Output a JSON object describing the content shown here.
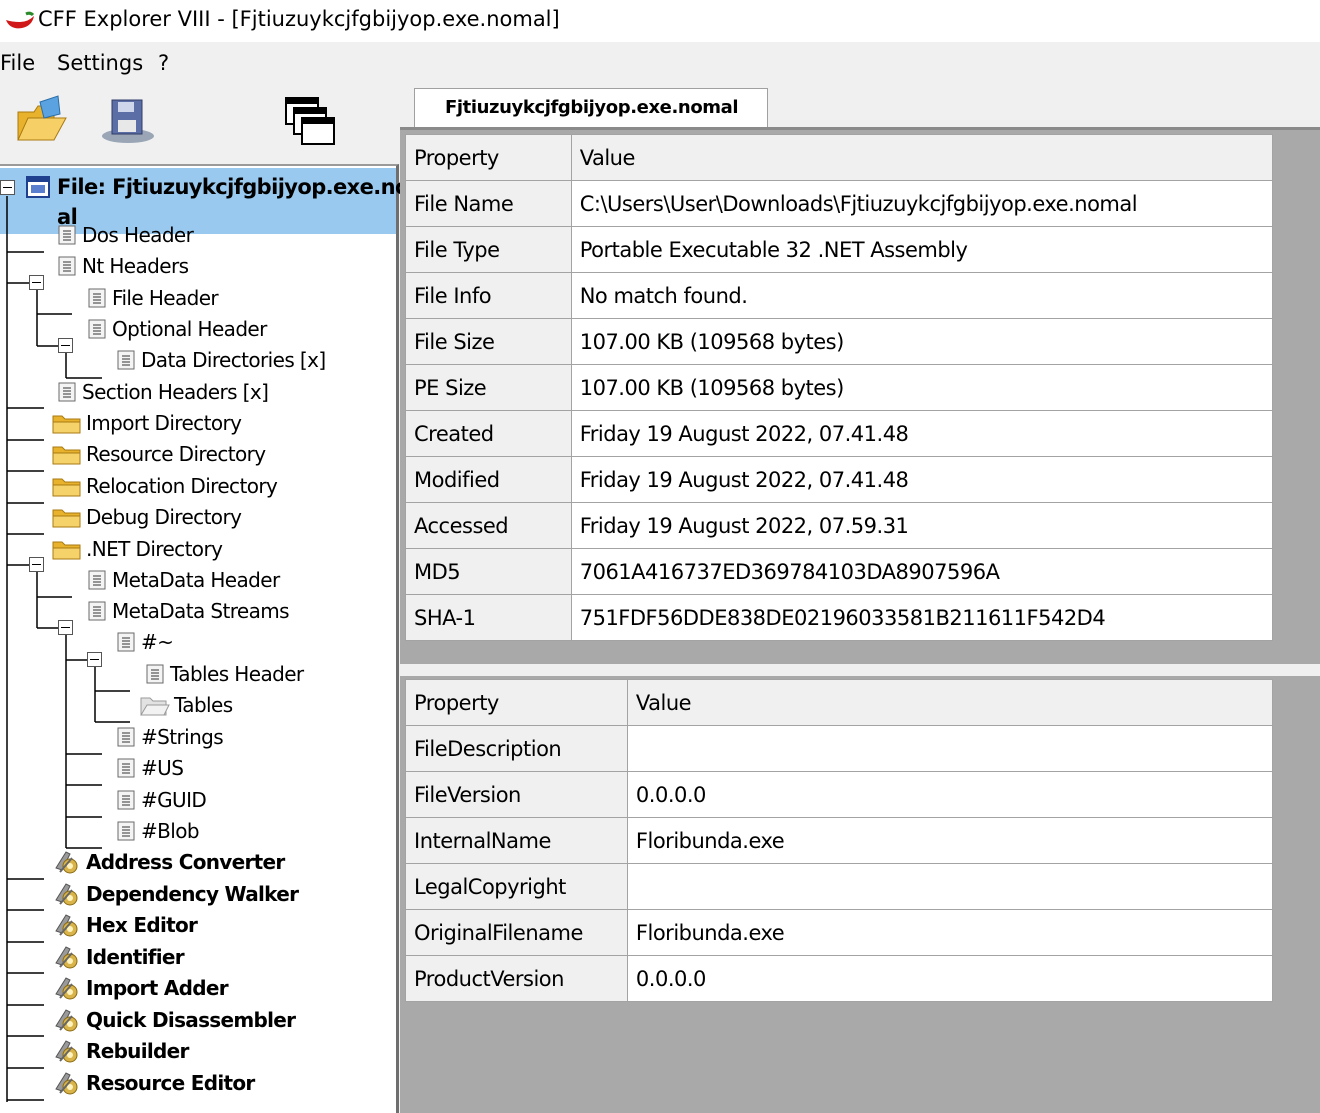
{
  "window": {
    "title": "CFF Explorer VIII - [Fjtiuzuykcjfgbijyop.exe.nomal]"
  },
  "menu": [
    "File",
    "Settings",
    "?"
  ],
  "toolbar": {
    "open_icon": "open-folder-icon",
    "save_icon": "save-disk-icon",
    "windows_icon": "windows-cascade-icon"
  },
  "tree": {
    "root": "File: Fjtiuzuykcjfgbijyop.exe.nom",
    "root_wrap": "al",
    "items": [
      {
        "label": "Dos Header",
        "icon": "doc-icon",
        "bold": false
      },
      {
        "label": "Nt Headers",
        "icon": "doc-icon",
        "bold": false
      },
      {
        "label": "File Header",
        "icon": "doc-icon",
        "bold": false
      },
      {
        "label": "Optional Header",
        "icon": "doc-icon",
        "bold": false
      },
      {
        "label": "Data Directories [x]",
        "icon": "doc-icon",
        "bold": false
      },
      {
        "label": "Section Headers [x]",
        "icon": "doc-icon",
        "bold": false
      },
      {
        "label": "Import Directory",
        "icon": "folder-icon",
        "bold": false
      },
      {
        "label": "Resource Directory",
        "icon": "folder-icon",
        "bold": false
      },
      {
        "label": "Relocation Directory",
        "icon": "folder-icon",
        "bold": false
      },
      {
        "label": "Debug Directory",
        "icon": "folder-icon",
        "bold": false
      },
      {
        "label": ".NET Directory",
        "icon": "folder-icon",
        "bold": false
      },
      {
        "label": "MetaData Header",
        "icon": "doc-icon",
        "bold": false
      },
      {
        "label": "MetaData Streams",
        "icon": "doc-icon",
        "bold": false
      },
      {
        "label": "#~",
        "icon": "doc-icon",
        "bold": false
      },
      {
        "label": "Tables Header",
        "icon": "doc-icon",
        "bold": false
      },
      {
        "label": "Tables",
        "icon": "folder-open-icon",
        "bold": false
      },
      {
        "label": "#Strings",
        "icon": "doc-icon",
        "bold": false
      },
      {
        "label": "#US",
        "icon": "doc-icon",
        "bold": false
      },
      {
        "label": "#GUID",
        "icon": "doc-icon",
        "bold": false
      },
      {
        "label": "#Blob",
        "icon": "doc-icon",
        "bold": false
      },
      {
        "label": "Address Converter",
        "icon": "tool-icon",
        "bold": true
      },
      {
        "label": "Dependency Walker",
        "icon": "tool-icon",
        "bold": true
      },
      {
        "label": "Hex Editor",
        "icon": "tool-icon",
        "bold": true
      },
      {
        "label": "Identifier",
        "icon": "tool-icon",
        "bold": true
      },
      {
        "label": "Import Adder",
        "icon": "tool-icon",
        "bold": true
      },
      {
        "label": "Quick Disassembler",
        "icon": "tool-icon",
        "bold": true
      },
      {
        "label": "Rebuilder",
        "icon": "tool-icon",
        "bold": true
      },
      {
        "label": "Resource Editor",
        "icon": "tool-icon",
        "bold": true
      }
    ]
  },
  "tab": {
    "label": "Fjtiuzuykcjfgbijyop.exe.nomal"
  },
  "grid1": {
    "headers": [
      "Property",
      "Value"
    ],
    "rows": [
      [
        "File Name",
        "C:\\Users\\User\\Downloads\\Fjtiuzuykcjfgbijyop.exe.nomal"
      ],
      [
        "File Type",
        "Portable Executable 32 .NET Assembly"
      ],
      [
        "File Info",
        "No match found."
      ],
      [
        "File Size",
        "107.00 KB (109568 bytes)"
      ],
      [
        "PE Size",
        "107.00 KB (109568 bytes)"
      ],
      [
        "Created",
        "Friday 19 August 2022, 07.41.48"
      ],
      [
        "Modified",
        "Friday 19 August 2022, 07.41.48"
      ],
      [
        "Accessed",
        "Friday 19 August 2022, 07.59.31"
      ],
      [
        "MD5",
        "7061A416737ED369784103DA8907596A"
      ],
      [
        "SHA-1",
        "751FDF56DDE838DE02196033581B211611F542D4"
      ]
    ]
  },
  "grid2": {
    "headers": [
      "Property",
      "Value"
    ],
    "rows": [
      [
        "FileDescription",
        ""
      ],
      [
        "FileVersion",
        "0.0.0.0"
      ],
      [
        "InternalName",
        "Floribunda.exe"
      ],
      [
        "LegalCopyright",
        ""
      ],
      [
        "OriginalFilename",
        "Floribunda.exe"
      ],
      [
        "ProductVersion",
        "0.0.0.0"
      ]
    ]
  }
}
